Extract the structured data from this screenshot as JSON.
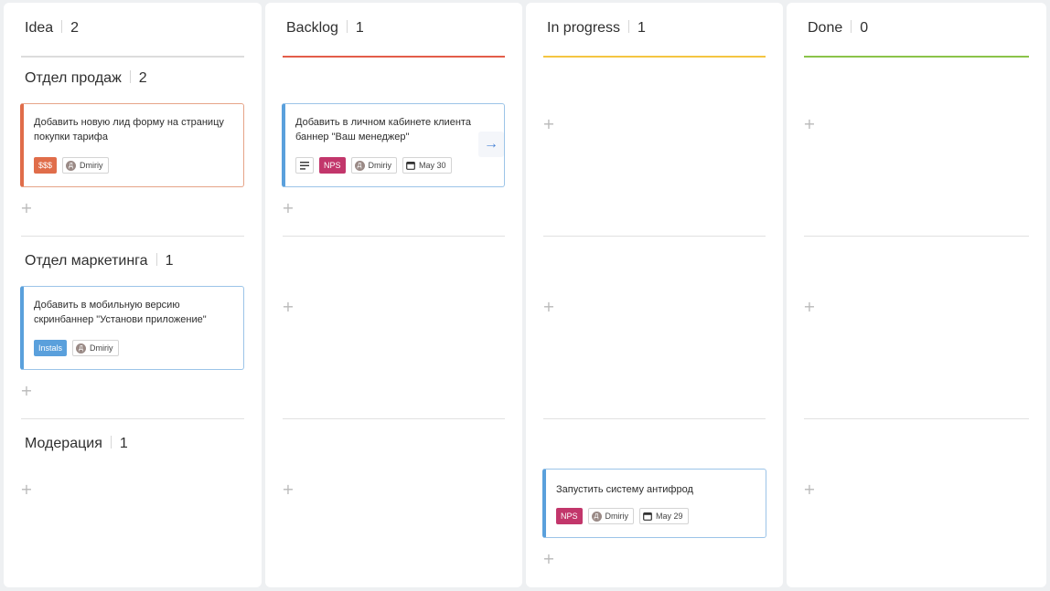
{
  "columns": [
    {
      "title": "Idea",
      "count": "2",
      "accent": "#dcdcdc"
    },
    {
      "title": "Backlog",
      "count": "1",
      "accent": "#e35d4a"
    },
    {
      "title": "In progress",
      "count": "1",
      "accent": "#f4c542"
    },
    {
      "title": "Done",
      "count": "0",
      "accent": "#8bc34a"
    }
  ],
  "swimlanes": [
    {
      "title": "Отдел продаж",
      "count": "2"
    },
    {
      "title": "Отдел маркетинга",
      "count": "1"
    },
    {
      "title": "Модерация",
      "count": "1"
    }
  ],
  "plus_glyph": "+",
  "cards": {
    "idea_sales": {
      "text": "Добавить новую лид форму на страницу покупки тарифа",
      "tag": "$$$",
      "tag_color": "#e06d4a",
      "assignee": "Dmiriy",
      "avatar_letter": "Д"
    },
    "backlog_sales": {
      "text": "Добавить в личном кабинете клиента баннер \"Ваш менеджер\"",
      "tag": "NPS",
      "tag_color": "#c2366b",
      "assignee": "Dmiriy",
      "avatar_letter": "Д",
      "date": "May 30",
      "arrow": "→"
    },
    "idea_marketing": {
      "text": "Добавить в мобильную версию скринбаннер \"Установи приложение\"",
      "tag": "Instals",
      "tag_color": "#5aa0dc",
      "assignee": "Dmiriy",
      "avatar_letter": "Д"
    },
    "progress_moderation": {
      "text": "Запустить систему антифрод",
      "tag": "NPS",
      "tag_color": "#c2366b",
      "assignee": "Dmiriy",
      "avatar_letter": "Д",
      "date": "May 29"
    }
  }
}
